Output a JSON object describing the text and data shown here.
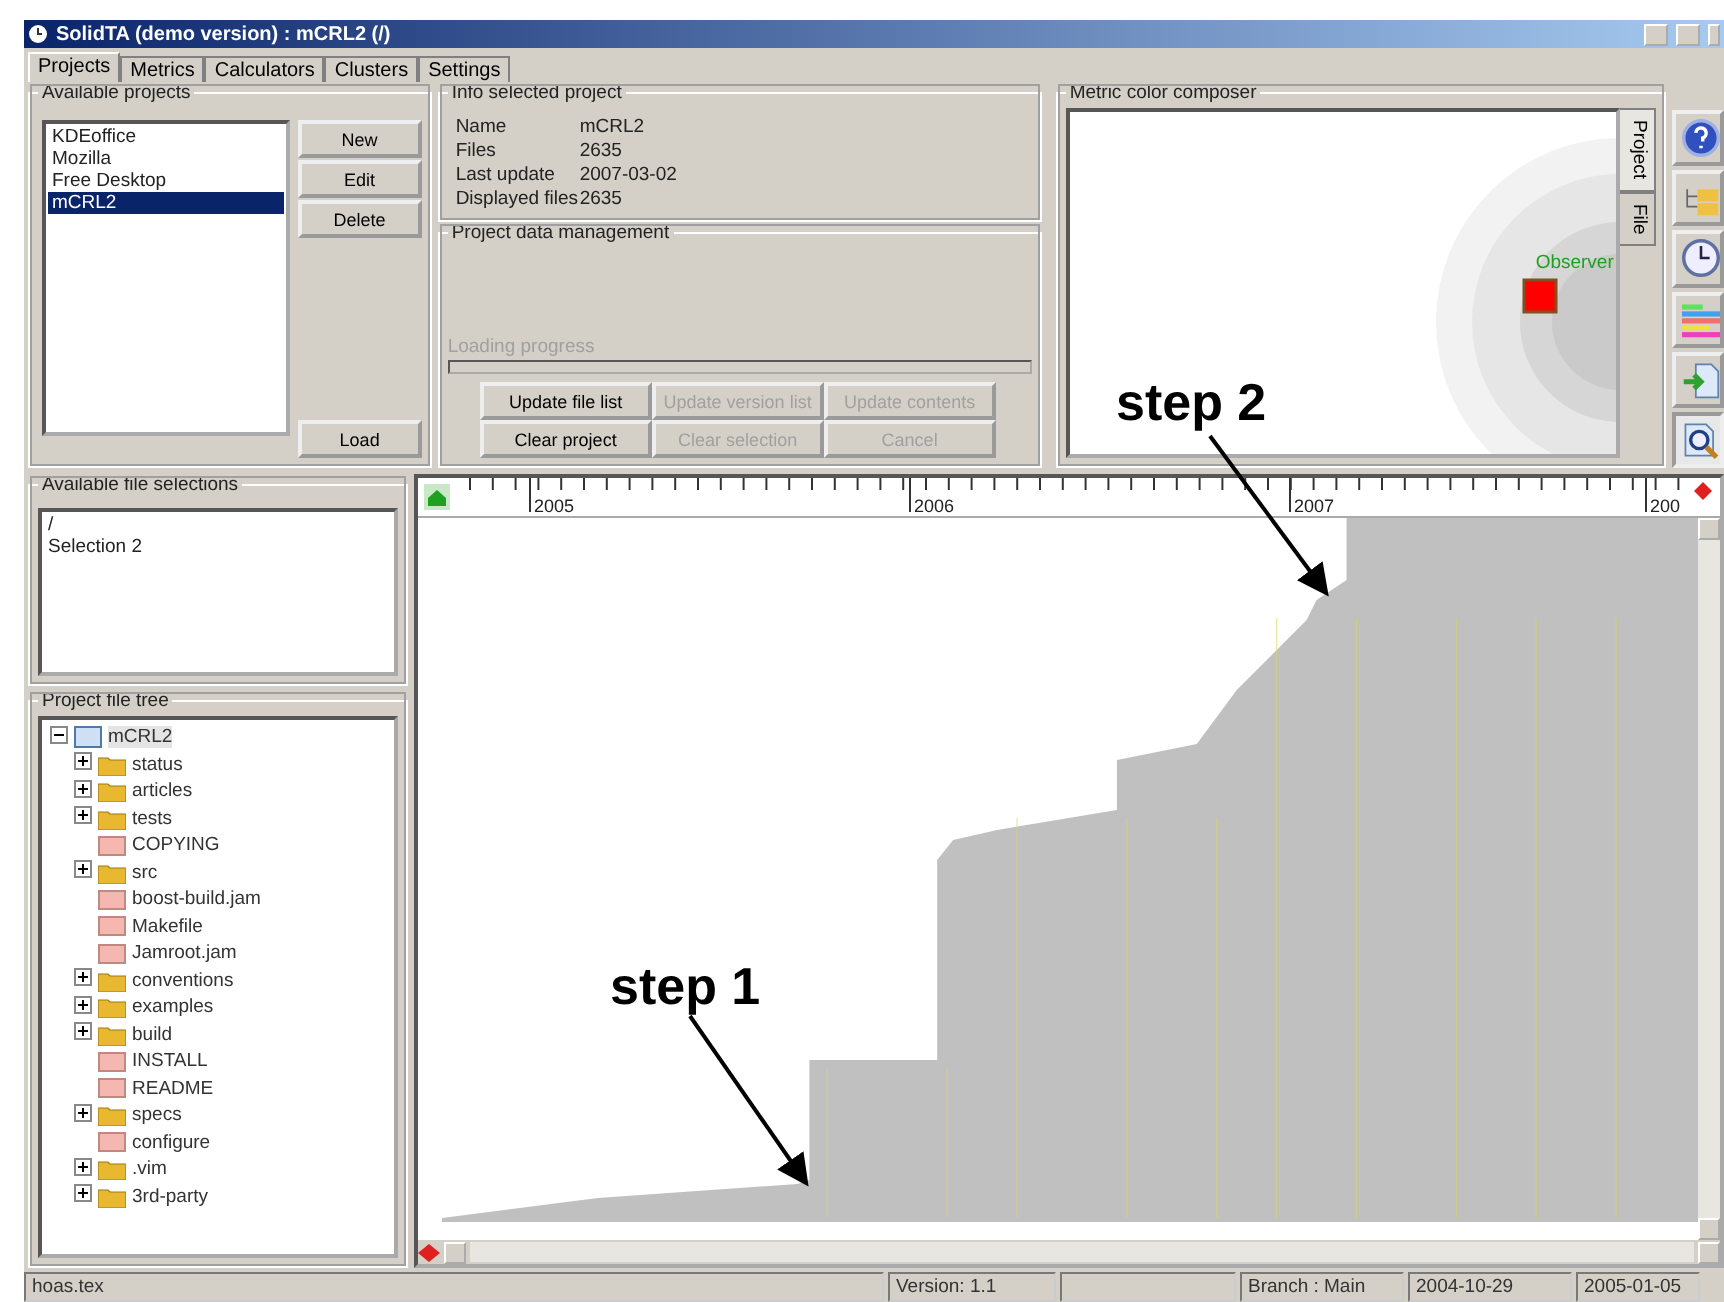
{
  "window": {
    "title": "SolidTA (demo version) : mCRL2 (/)"
  },
  "tabs": [
    {
      "label": "Projects",
      "selected": true
    },
    {
      "label": "Metrics",
      "selected": false
    },
    {
      "label": "Calculators",
      "selected": false
    },
    {
      "label": "Clusters",
      "selected": false
    },
    {
      "label": "Settings",
      "selected": false
    }
  ],
  "available_projects": {
    "title": "Available projects",
    "items": [
      {
        "label": "KDEoffice",
        "selected": false
      },
      {
        "label": "Mozilla",
        "selected": false
      },
      {
        "label": "Free Desktop",
        "selected": false
      },
      {
        "label": "mCRL2",
        "selected": true
      }
    ],
    "buttons": [
      "New",
      "Edit",
      "Delete"
    ],
    "load_button": "Load"
  },
  "info": {
    "title": "Info selected project",
    "rows": [
      {
        "label": "Name",
        "value": "mCRL2"
      },
      {
        "label": "Files",
        "value": "2635"
      },
      {
        "label": "Last update",
        "value": "2007-03-02"
      },
      {
        "label": "Displayed files",
        "value": "2635"
      }
    ]
  },
  "data_management": {
    "title": "Project data management",
    "progress_label": "Loading progress",
    "progress": {
      "level": 0
    },
    "buttons": [
      {
        "label": "Update file list",
        "disabled": false
      },
      {
        "label": "Update version list",
        "disabled": true
      },
      {
        "label": "Update contents",
        "disabled": true
      },
      {
        "label": "Clear project",
        "disabled": false
      },
      {
        "label": "Clear selection",
        "disabled": true
      },
      {
        "label": "Cancel",
        "disabled": true
      }
    ]
  },
  "composer": {
    "title": "Metric color composer",
    "observer_label": "Observer",
    "side_tabs": [
      {
        "label": "Project",
        "selected": true
      },
      {
        "label": "File",
        "selected": false
      }
    ]
  },
  "toolbar": [
    {
      "kind": "help",
      "selected": false
    },
    {
      "kind": "tree",
      "selected": false
    },
    {
      "kind": "clock",
      "selected": false
    },
    {
      "kind": "bars",
      "selected": false
    },
    {
      "kind": "import",
      "selected": false
    },
    {
      "kind": "zoom",
      "selected": true
    }
  ],
  "file_selections": {
    "title": "Available file selections",
    "items": [
      "/",
      "Selection 2"
    ]
  },
  "file_tree": {
    "title": "Project file tree",
    "root": {
      "label": "mCRL2",
      "kind": "root",
      "expanded": true,
      "selected": true,
      "children": [
        {
          "label": "status",
          "kind": "folder",
          "expanded": false,
          "selected": false
        },
        {
          "label": "articles",
          "kind": "folder",
          "expanded": false,
          "selected": false
        },
        {
          "label": "tests",
          "kind": "folder",
          "expanded": false,
          "selected": false
        },
        {
          "label": "COPYING",
          "kind": "file",
          "selected": false
        },
        {
          "label": "src",
          "kind": "folder",
          "expanded": false,
          "selected": false
        },
        {
          "label": "boost-build.jam",
          "kind": "file",
          "selected": false
        },
        {
          "label": "Makefile",
          "kind": "file",
          "selected": false
        },
        {
          "label": "Jamroot.jam",
          "kind": "file",
          "selected": false
        },
        {
          "label": "conventions",
          "kind": "folder",
          "expanded": false,
          "selected": false
        },
        {
          "label": "examples",
          "kind": "folder",
          "expanded": false,
          "selected": false
        },
        {
          "label": "build",
          "kind": "folder",
          "expanded": false,
          "selected": false
        },
        {
          "label": "INSTALL",
          "kind": "file",
          "selected": false
        },
        {
          "label": "README",
          "kind": "file",
          "selected": false
        },
        {
          "label": "specs",
          "kind": "folder",
          "expanded": false,
          "selected": false
        },
        {
          "label": "configure",
          "kind": "file",
          "selected": false
        },
        {
          "label": ".vim",
          "kind": "folder",
          "expanded": false,
          "selected": false
        },
        {
          "label": "3rd-party",
          "kind": "folder",
          "expanded": false,
          "selected": false
        }
      ]
    }
  },
  "timeline": {
    "ruler_labels": [
      "2005",
      "2006",
      "2007",
      "200"
    ]
  },
  "annotations": [
    "step 1",
    "step 2"
  ],
  "status_bar": [
    "hoas.tex",
    "Version: 1.1",
    "Branch : Main",
    "2004-10-29",
    "2005-01-05"
  ]
}
